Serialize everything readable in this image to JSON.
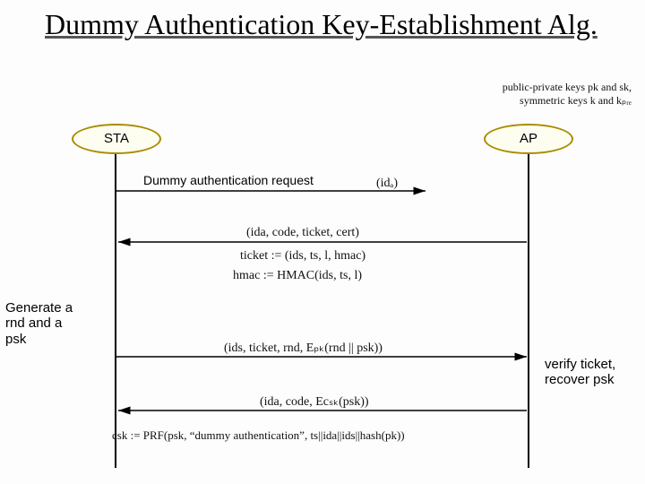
{
  "title": "Dummy Authentication Key-Establishment Alg.",
  "legend": {
    "line1": "public-private keys  pk  and  sk,",
    "line2": "symmetric keys  k  and  kₚᵣₑ"
  },
  "actors": {
    "sta": "STA",
    "ap": "AP"
  },
  "messages": {
    "m1_label": "Dummy authentication request",
    "m1_payload": "(idₐ)",
    "m2_payload": "(ida, code, ticket, cert)",
    "m2_def_ticket": "ticket := (ids, ts, l, hmac)",
    "m2_def_hmac": "hmac := HMAC(ids, ts, l)",
    "m3_payload": "(ids, ticket, rnd, Eₚₖ(rnd || psk))",
    "m4_payload": "(ida, code, Ecₛₖ(psk))",
    "csk_def": "csk := PRF(psk, “dummy authentication”, ts||ida||ids||hash(pk))"
  },
  "notes": {
    "sta_generate": "Generate a rnd and a psk",
    "ap_verify": "verify ticket, recover psk"
  }
}
